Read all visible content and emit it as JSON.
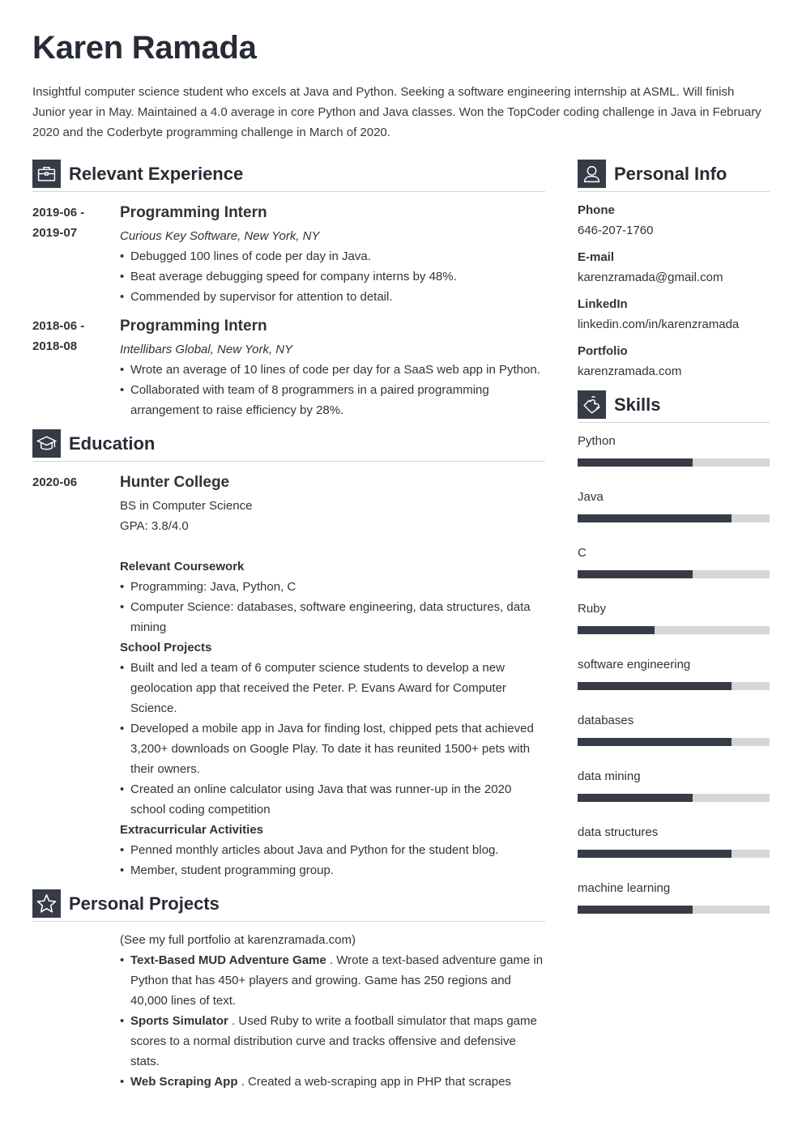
{
  "header": {
    "name": "Karen Ramada",
    "summary": "Insightful computer science student who excels at Java and Python. Seeking a software engineering internship at ASML. Will finish Junior year in May. Maintained a 4.0 average in core Python and Java classes. Won the TopCoder coding challenge in Java in February 2020 and the Coderbyte programming challenge in March of 2020."
  },
  "experience": {
    "title": "Relevant Experience",
    "icon": "briefcase-icon",
    "entries": [
      {
        "date_start": "2019-06 -",
        "date_end": "2019-07",
        "role": "Programming Intern",
        "company": "Curious Key Software, New York, NY",
        "bullets": [
          "Debugged 100 lines of code per day in Java.",
          "Beat average debugging speed for company interns by 48%.",
          "Commended by supervisor for attention to detail."
        ]
      },
      {
        "date_start": "2018-06 -",
        "date_end": "2018-08",
        "role": "Programming Intern",
        "company": "Intellibars Global, New York, NY",
        "bullets": [
          "Wrote an average of 10 lines of code per day for a SaaS web app in Python.",
          "Collaborated with team of 8 programmers in a paired programming arrangement to raise efficiency by 28%."
        ]
      }
    ]
  },
  "education": {
    "title": "Education",
    "icon": "graduation-cap-icon",
    "date": "2020-06",
    "school": "Hunter College",
    "degree": "BS in Computer Science",
    "gpa": "GPA: 3.8/4.0",
    "coursework_title": "Relevant Coursework",
    "coursework": [
      "Programming: Java, Python, C",
      "Computer Science: databases, software engineering, data structures, data mining"
    ],
    "projects_title": "School Projects",
    "projects": [
      "Built and led a team of 6 computer science students to develop a new geolocation app that received the Peter. P. Evans Award for Computer Science.",
      "Developed a mobile app in Java for finding lost, chipped pets that achieved 3,200+ downloads on Google Play. To date it has reunited 1500+ pets with their owners.",
      "Created an online calculator using Java that was runner-up in the 2020 school coding competition"
    ],
    "activities_title": "Extracurricular Activities",
    "activities": [
      "Penned monthly articles about Java and Python for the student blog.",
      "Member, student programming group."
    ]
  },
  "projects": {
    "title": "Personal Projects",
    "icon": "star-icon",
    "intro": "(See my full portfolio at karenzramada.com)",
    "items": [
      {
        "name": "Text-Based MUD Adventure Game",
        "desc": " . Wrote a text-based adventure game in Python that has 450+ players and growing. Game has 250 regions and 40,000 lines of text."
      },
      {
        "name": "Sports Simulator",
        "desc": " . Used Ruby to write a football simulator that maps game scores to a normal distribution curve and tracks offensive and defensive stats."
      },
      {
        "name": "Web Scraping App",
        "desc": " . Created a web-scraping app in PHP that scrapes"
      }
    ]
  },
  "personal_info": {
    "title": "Personal Info",
    "icon": "person-icon",
    "fields": [
      {
        "label": "Phone",
        "value": "646-207-1760"
      },
      {
        "label": "E-mail",
        "value": "karenzramada@gmail.com"
      },
      {
        "label": "LinkedIn",
        "value": "linkedin.com/in/karenzramada"
      },
      {
        "label": "Portfolio",
        "value": "karenzramada.com"
      }
    ]
  },
  "skills": {
    "title": "Skills",
    "icon": "puzzle-icon",
    "items": [
      {
        "name": "Python",
        "level": 0.6
      },
      {
        "name": "Java",
        "level": 0.8
      },
      {
        "name": "C",
        "level": 0.6
      },
      {
        "name": "Ruby",
        "level": 0.4
      },
      {
        "name": "software engineering",
        "level": 0.8
      },
      {
        "name": "databases",
        "level": 0.8
      },
      {
        "name": "data mining",
        "level": 0.6
      },
      {
        "name": "data structures",
        "level": 0.8
      },
      {
        "name": "machine learning",
        "level": 0.6
      }
    ]
  },
  "colors": {
    "dark": "#363b47",
    "bar_bg": "#d5d6d6",
    "rule": "#d6d6d6"
  }
}
